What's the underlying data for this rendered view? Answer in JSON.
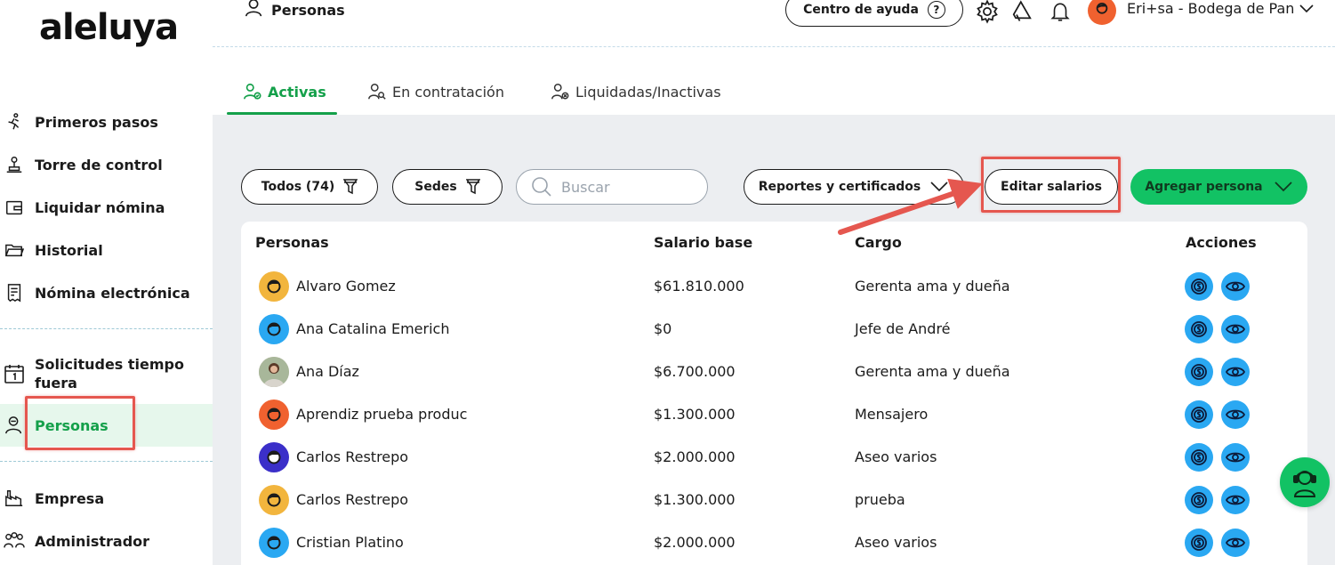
{
  "brand": {
    "logo_text": "aleluya"
  },
  "sidebar": {
    "items": [
      {
        "label": "Primeros pasos",
        "icon": "runner-icon"
      },
      {
        "label": "Torre de control",
        "icon": "control-tower-icon"
      },
      {
        "label": "Liquidar nómina",
        "icon": "wallet-icon"
      },
      {
        "label": "Historial",
        "icon": "folder-icon"
      },
      {
        "label": "Nómina electrónica",
        "icon": "receipt-icon"
      },
      {
        "label": "Solicitudes tiempo fuera",
        "icon": "calendar-icon"
      },
      {
        "label": "Personas",
        "icon": "person-icon",
        "active": true
      },
      {
        "label": "Empresa",
        "icon": "factory-icon"
      },
      {
        "label": "Administrador",
        "icon": "users-group-icon"
      }
    ]
  },
  "header": {
    "title": "Personas",
    "help_label": "Centro de ayuda",
    "help_symbol": "?",
    "user_name": "Eri+sa - Bodega de Pan"
  },
  "tabs": [
    {
      "label": "Activas",
      "active": true
    },
    {
      "label": "En contratación"
    },
    {
      "label": "Liquidadas/Inactivas"
    }
  ],
  "toolbar": {
    "filter_all": "Todos (74)",
    "filter_sedes": "Sedes",
    "search_placeholder": "Buscar",
    "reports_label": "Reportes y certificados",
    "edit_salaries_label": "Editar salarios",
    "add_person_label": "Agregar persona"
  },
  "table": {
    "headers": {
      "persons": "Personas",
      "salary": "Salario base",
      "cargo": "Cargo",
      "actions": "Acciones"
    },
    "rows": [
      {
        "name": "Alvaro Gomez",
        "salary": "$61.810.000",
        "cargo": "Gerenta ama y dueña",
        "avatar_color": "#f2b53d"
      },
      {
        "name": "Ana Catalina Emerich",
        "salary": "$0",
        "cargo": "Jefe de André",
        "avatar_color": "#2aa8f2"
      },
      {
        "name": "Ana  Díaz",
        "salary": "$6.700.000",
        "cargo": "Gerenta ama y dueña",
        "avatar_color": "photo"
      },
      {
        "name": "Aprendiz prueba produc",
        "salary": "$1.300.000",
        "cargo": "Mensajero",
        "avatar_color": "#f0612f"
      },
      {
        "name": "Carlos Restrepo",
        "salary": "$2.000.000",
        "cargo": "Aseo varios",
        "avatar_color": "#3b2fc9"
      },
      {
        "name": "Carlos Restrepo",
        "salary": "$1.300.000",
        "cargo": "prueba",
        "avatar_color": "#f2b53d"
      },
      {
        "name": "Cristian Platino",
        "salary": "$2.000.000",
        "cargo": "Aseo varios",
        "avatar_color": "#2aa8f2"
      }
    ]
  },
  "colors": {
    "accent_green": "#12c264",
    "active_green_text": "#14a04a",
    "action_blue": "#2aa8f2",
    "annotation_red": "#e5574f",
    "content_bg": "#eceef1"
  }
}
